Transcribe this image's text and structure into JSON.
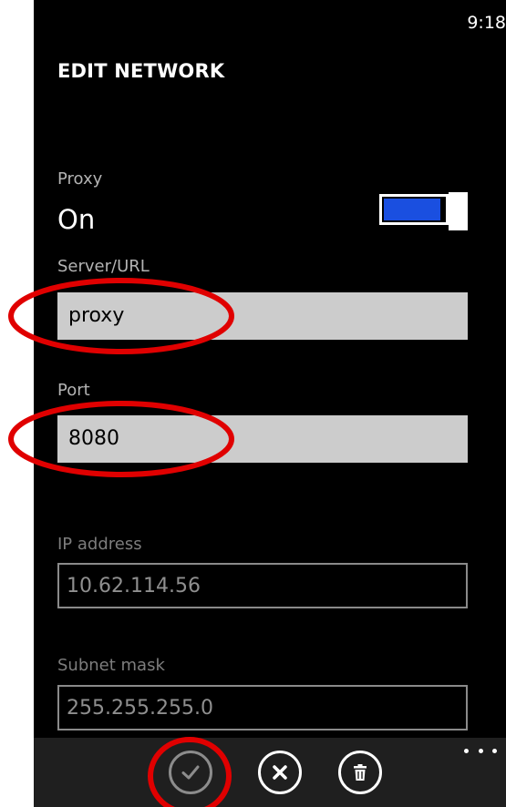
{
  "status_bar": {
    "time": "9:18"
  },
  "page": {
    "title": "EDIT NETWORK"
  },
  "proxy": {
    "label": "Proxy",
    "state_text": "On",
    "enabled": true,
    "toggle_color": "#1a4fe0"
  },
  "server": {
    "label": "Server/URL",
    "value": "proxy"
  },
  "port": {
    "label": "Port",
    "value": "8080"
  },
  "ip_address": {
    "label": "IP address",
    "value": "10.62.114.56"
  },
  "subnet_mask": {
    "label": "Subnet mask",
    "value": "255.255.255.0"
  },
  "app_bar": {
    "buttons": [
      {
        "icon": "checkmark-icon"
      },
      {
        "icon": "close-icon"
      },
      {
        "icon": "trash-icon"
      }
    ],
    "more_icon": "ellipsis-icon"
  },
  "annotation_color": "#e00000"
}
